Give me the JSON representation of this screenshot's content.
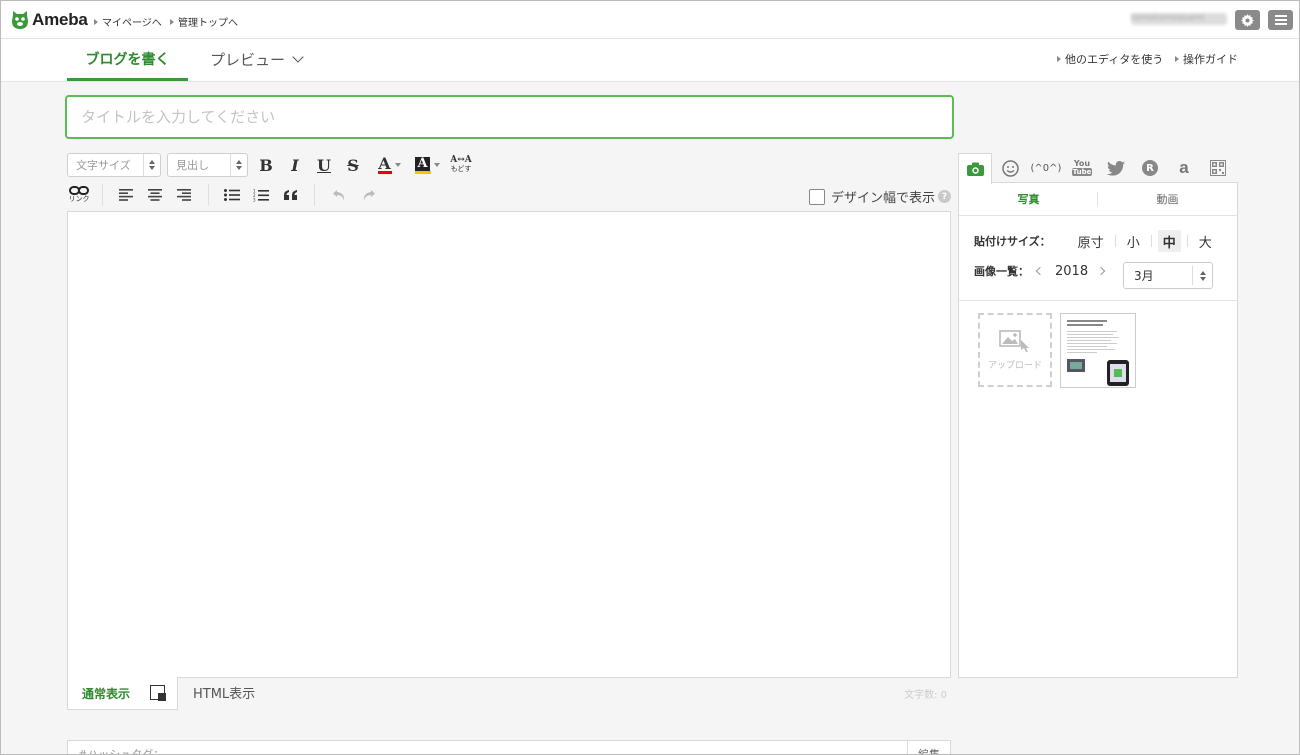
{
  "header": {
    "logo_text": "Ameba",
    "links": [
      "マイページへ",
      "管理トップへ"
    ],
    "username": "tomotomoasami"
  },
  "tabs": {
    "write": "ブログを書く",
    "preview": "プレビュー",
    "right_links": [
      "他のエディタを使う",
      "操作ガイド"
    ]
  },
  "title_input": {
    "placeholder": "タイトルを入力してください",
    "value": ""
  },
  "toolbar": {
    "font_size": "文字サイズ",
    "heading": "見出し",
    "bold": "B",
    "italic": "I",
    "underline": "U",
    "strike": "S",
    "font_color": "A",
    "bg_color": "A",
    "reset_top": "A↔A",
    "reset_bottom": "もどす",
    "link_label": "リンク",
    "design_width": "デザイン幅で表示",
    "help": "?",
    "colors": {
      "font_color": "#e60012",
      "bg_color": "#f5c400",
      "accent": "#3a9a3a"
    }
  },
  "editor_footer": {
    "normal": "通常表示",
    "html": "HTML表示",
    "char_count": "文字数: 0"
  },
  "hashtag": {
    "label": "#ハッシュタグ：",
    "edit": "編集"
  },
  "side_panel": {
    "tabs": [
      "camera-icon",
      "emoji-icon",
      "(^0^)",
      "youtube-icon",
      "twitter-icon",
      "rakuten-icon",
      "amazon-icon",
      "qr-icon"
    ],
    "kaomoji": "(^0^)",
    "youtube_top": "You",
    "youtube_bottom": "Tube",
    "rakuten": "R",
    "amazon": "a",
    "subtabs": [
      "写真",
      "動画"
    ],
    "paste_size_label": "貼付けサイズ：",
    "sizes": [
      "原寸",
      "小",
      "中",
      "大"
    ],
    "selected_size": "中",
    "image_list_label": "画像一覧：",
    "year": "2018",
    "month": "3月",
    "upload_label": "アップロード"
  }
}
